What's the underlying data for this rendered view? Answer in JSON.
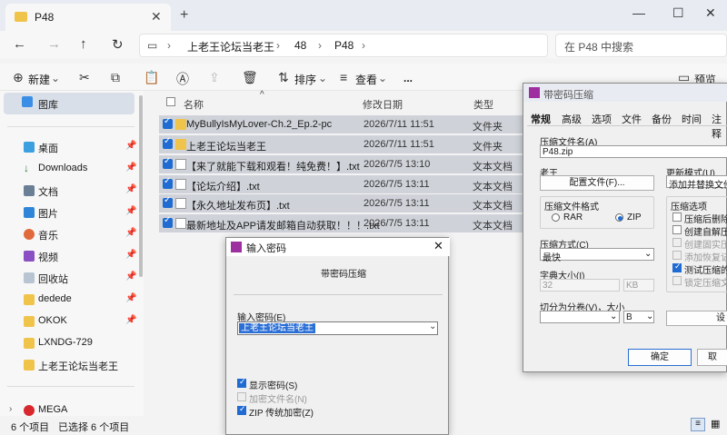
{
  "explorer": {
    "tab_title": "P48",
    "new_tab": "+",
    "breadcrumb": [
      "上老王论坛当老王",
      "48",
      "P48"
    ],
    "search_placeholder": "在 P48 中搜索",
    "toolbar": {
      "new": "新建",
      "sort": "排序",
      "view": "查看",
      "more": "...",
      "preview": "预览"
    },
    "sidebar": {
      "gallery": "图库",
      "items": [
        {
          "label": "桌面",
          "icon": "desktop-icon"
        },
        {
          "label": "Downloads",
          "icon": "download-icon"
        },
        {
          "label": "文档",
          "icon": "document-icon"
        },
        {
          "label": "图片",
          "icon": "picture-icon"
        },
        {
          "label": "音乐",
          "icon": "music-icon"
        },
        {
          "label": "视频",
          "icon": "video-icon"
        },
        {
          "label": "回收站",
          "icon": "recycle-bin-icon"
        },
        {
          "label": "dedede",
          "icon": "folder-icon"
        },
        {
          "label": "OKOK",
          "icon": "folder-icon"
        },
        {
          "label": "LXNDG-729",
          "icon": "folder-icon"
        },
        {
          "label": "上老王论坛当老王",
          "icon": "folder-icon"
        }
      ],
      "mega": "MEGA"
    },
    "columns": {
      "name": "名称",
      "date": "修改日期",
      "type": "类型"
    },
    "files": [
      {
        "name": "MyBullyIsMyLover-Ch.2_Ep.2-pc",
        "date": "2026/7/11 11:51",
        "type": "文件夹"
      },
      {
        "name": "上老王论坛当老王",
        "date": "2026/7/11 11:51",
        "type": "文件夹"
      },
      {
        "name": "【来了就能下载和观看！纯免费！】.txt",
        "date": "2026/7/5 13:10",
        "type": "文本文档"
      },
      {
        "name": "【论坛介绍】.txt",
        "date": "2026/7/5 13:11",
        "type": "文本文档"
      },
      {
        "name": "【永久地址发布页】.txt",
        "date": "2026/7/5 13:11",
        "type": "文本文档"
      },
      {
        "name": "最新地址及APP请发邮箱自动获取！！！.txt",
        "date": "2026/7/5 13:11",
        "type": "文本文档"
      }
    ],
    "status": {
      "count": "6 个项目",
      "selected": "已选择 6 个项目"
    }
  },
  "password_dialog": {
    "title": "输入密码",
    "subtitle": "带密码压缩",
    "field_label": "输入密码(E)",
    "password_value": "上老王论坛当老王",
    "show_password": "显示密码(S)",
    "encrypt_names": "加密文件名(N)",
    "zip_legacy": "ZIP 传统加密(Z)"
  },
  "archive_dialog": {
    "title": "带密码压缩",
    "tabs": [
      "常规",
      "高级",
      "选项",
      "文件",
      "备份",
      "时间",
      "注释"
    ],
    "archive_name_label": "压缩文件名(A)",
    "archive_name": "P48.zip",
    "profile_label": "老王",
    "profile_button": "配置文件(F)...",
    "update_mode_label": "更新模式(U)",
    "update_mode": "添加并替换文件",
    "format_label": "压缩文件格式",
    "format_rar": "RAR",
    "format_zip": "ZIP",
    "method_label": "压缩方式(C)",
    "method": "最快",
    "dict_label": "字典大小(I)",
    "dict_value": "32",
    "dict_unit": "KB",
    "split_label": "切分为分卷(V)，大小",
    "split_unit": "B",
    "options_label": "压缩选项",
    "options": [
      {
        "label": "压缩后删除原",
        "state": "off"
      },
      {
        "label": "创建自解压格",
        "state": "off"
      },
      {
        "label": "创建固实压缩",
        "state": "disabled"
      },
      {
        "label": "添加恢复记录",
        "state": "disabled"
      },
      {
        "label": "测试压缩的文",
        "state": "on"
      },
      {
        "label": "锁定压缩文件",
        "state": "disabled"
      }
    ],
    "set_button": "设",
    "ok": "确定",
    "cancel": "取"
  }
}
